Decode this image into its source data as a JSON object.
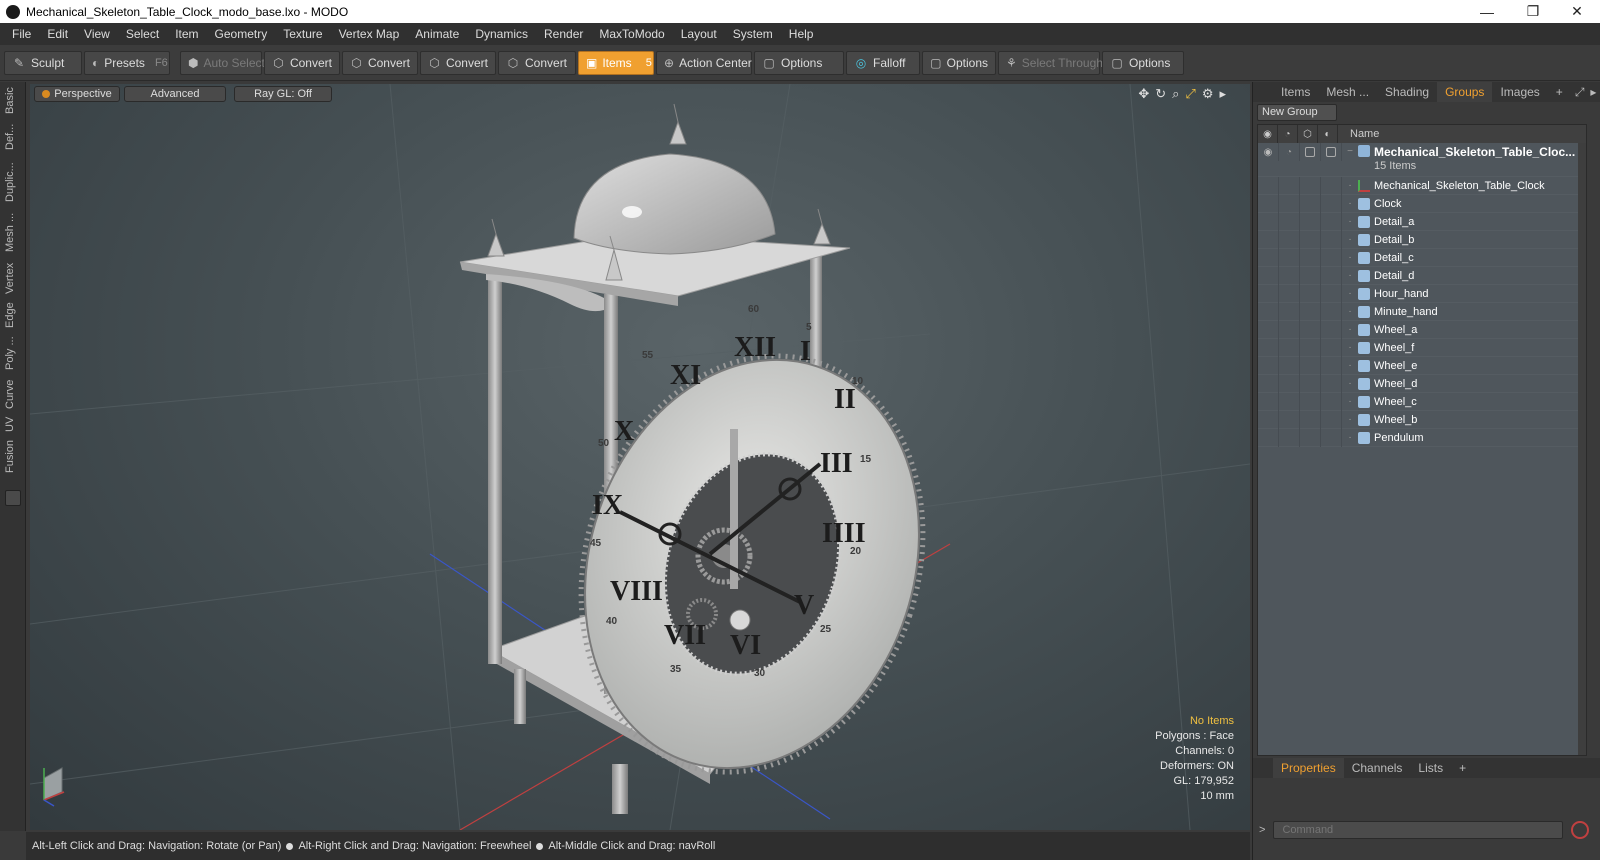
{
  "window": {
    "title": "Mechanical_Skeleton_Table_Clock_modo_base.lxo - MODO",
    "controls": [
      "—",
      "❐",
      "✕"
    ]
  },
  "menu": [
    "File",
    "Edit",
    "View",
    "Select",
    "Item",
    "Geometry",
    "Texture",
    "Vertex Map",
    "Animate",
    "Dynamics",
    "Render",
    "MaxToModo",
    "Layout",
    "System",
    "Help"
  ],
  "toolbar": {
    "sculpt": "Sculpt",
    "presets": "Presets",
    "presets_key": "F6",
    "auto_select": "Auto Select",
    "convert1": "Convert",
    "convert2": "Convert",
    "convert3": "Convert",
    "convert4": "Convert",
    "items": "Items",
    "items_key": "5",
    "action_center": "Action Center",
    "options1": "Options",
    "falloff": "Falloff",
    "options2": "Options",
    "select_through": "Select Through",
    "options3": "Options"
  },
  "left_tabs": [
    "Basic",
    "Def...",
    "Duplic...",
    "Mesh ...",
    "Vertex",
    "Edge",
    "Poly ...",
    "Curve",
    "UV",
    "Fusion"
  ],
  "viewport": {
    "view": "Perspective",
    "shading": "Advanced",
    "raygl": "Ray GL: Off",
    "info": {
      "selection": "No Items",
      "polygons": "Polygons : Face",
      "channels": "Channels: 0",
      "deformers": "Deformers: ON",
      "gl": "GL: 179,952",
      "unit": "10 mm"
    }
  },
  "status": {
    "hint1": "Alt-Left Click and Drag: Navigation: Rotate (or Pan)",
    "hint2": "Alt-Right Click and Drag: Navigation: Freewheel",
    "hint3": "Alt-Middle Click and Drag: navRoll"
  },
  "right_panel": {
    "tabs": [
      "Items",
      "Mesh ...",
      "Shading",
      "Groups",
      "Images"
    ],
    "active_tab": "Groups",
    "new_group": "New Group",
    "name_header": "Name",
    "group_name": "Mechanical_Skeleton_Table_Cloc...",
    "group_count": "15 Items",
    "items": [
      "Mechanical_Skeleton_Table_Clock",
      "Clock",
      "Detail_a",
      "Detail_b",
      "Detail_c",
      "Detail_d",
      "Hour_hand",
      "Minute_hand",
      "Wheel_a",
      "Wheel_f",
      "Wheel_e",
      "Wheel_d",
      "Wheel_c",
      "Wheel_b",
      "Pendulum"
    ],
    "bottom_tabs": [
      "Properties",
      "Channels",
      "Lists"
    ],
    "bottom_active": "Properties",
    "command_placeholder": "Command"
  },
  "clock": {
    "hour_numerals": [
      "XII",
      "I",
      "II",
      "III",
      "IIII",
      "V",
      "VI",
      "VII",
      "VIII",
      "IX",
      "X",
      "XI"
    ],
    "minute_labels": [
      "60",
      "5",
      "10",
      "15",
      "20",
      "25",
      "30",
      "35",
      "40",
      "45",
      "50",
      "55"
    ]
  }
}
